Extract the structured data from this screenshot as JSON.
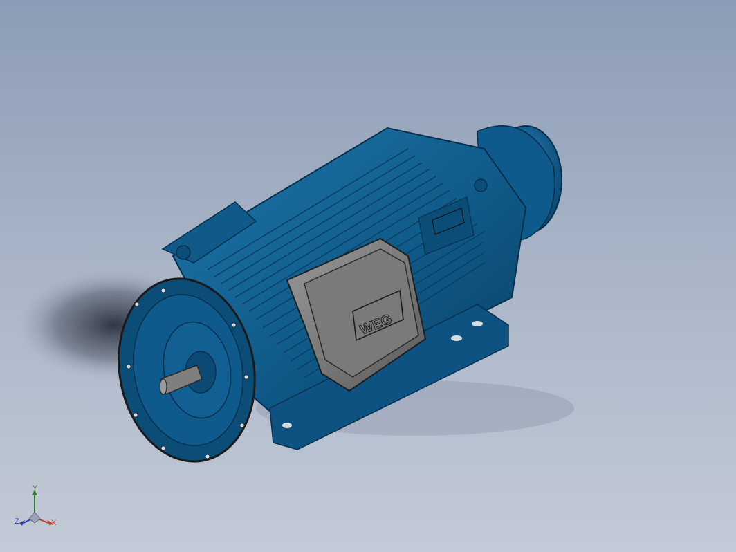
{
  "viewport": {
    "background_top": "#8c9cb6",
    "background_bottom": "#c3cad6"
  },
  "model": {
    "body_color": "#0f5a88",
    "terminal_box_color": "#6e6e6e",
    "brand_mark": "WEG"
  },
  "triad": {
    "x_label": "X",
    "y_label": "Y",
    "z_label": "Z",
    "x_color": "#c0392b",
    "y_color": "#2f7d2f",
    "z_color": "#2c3ea8"
  }
}
